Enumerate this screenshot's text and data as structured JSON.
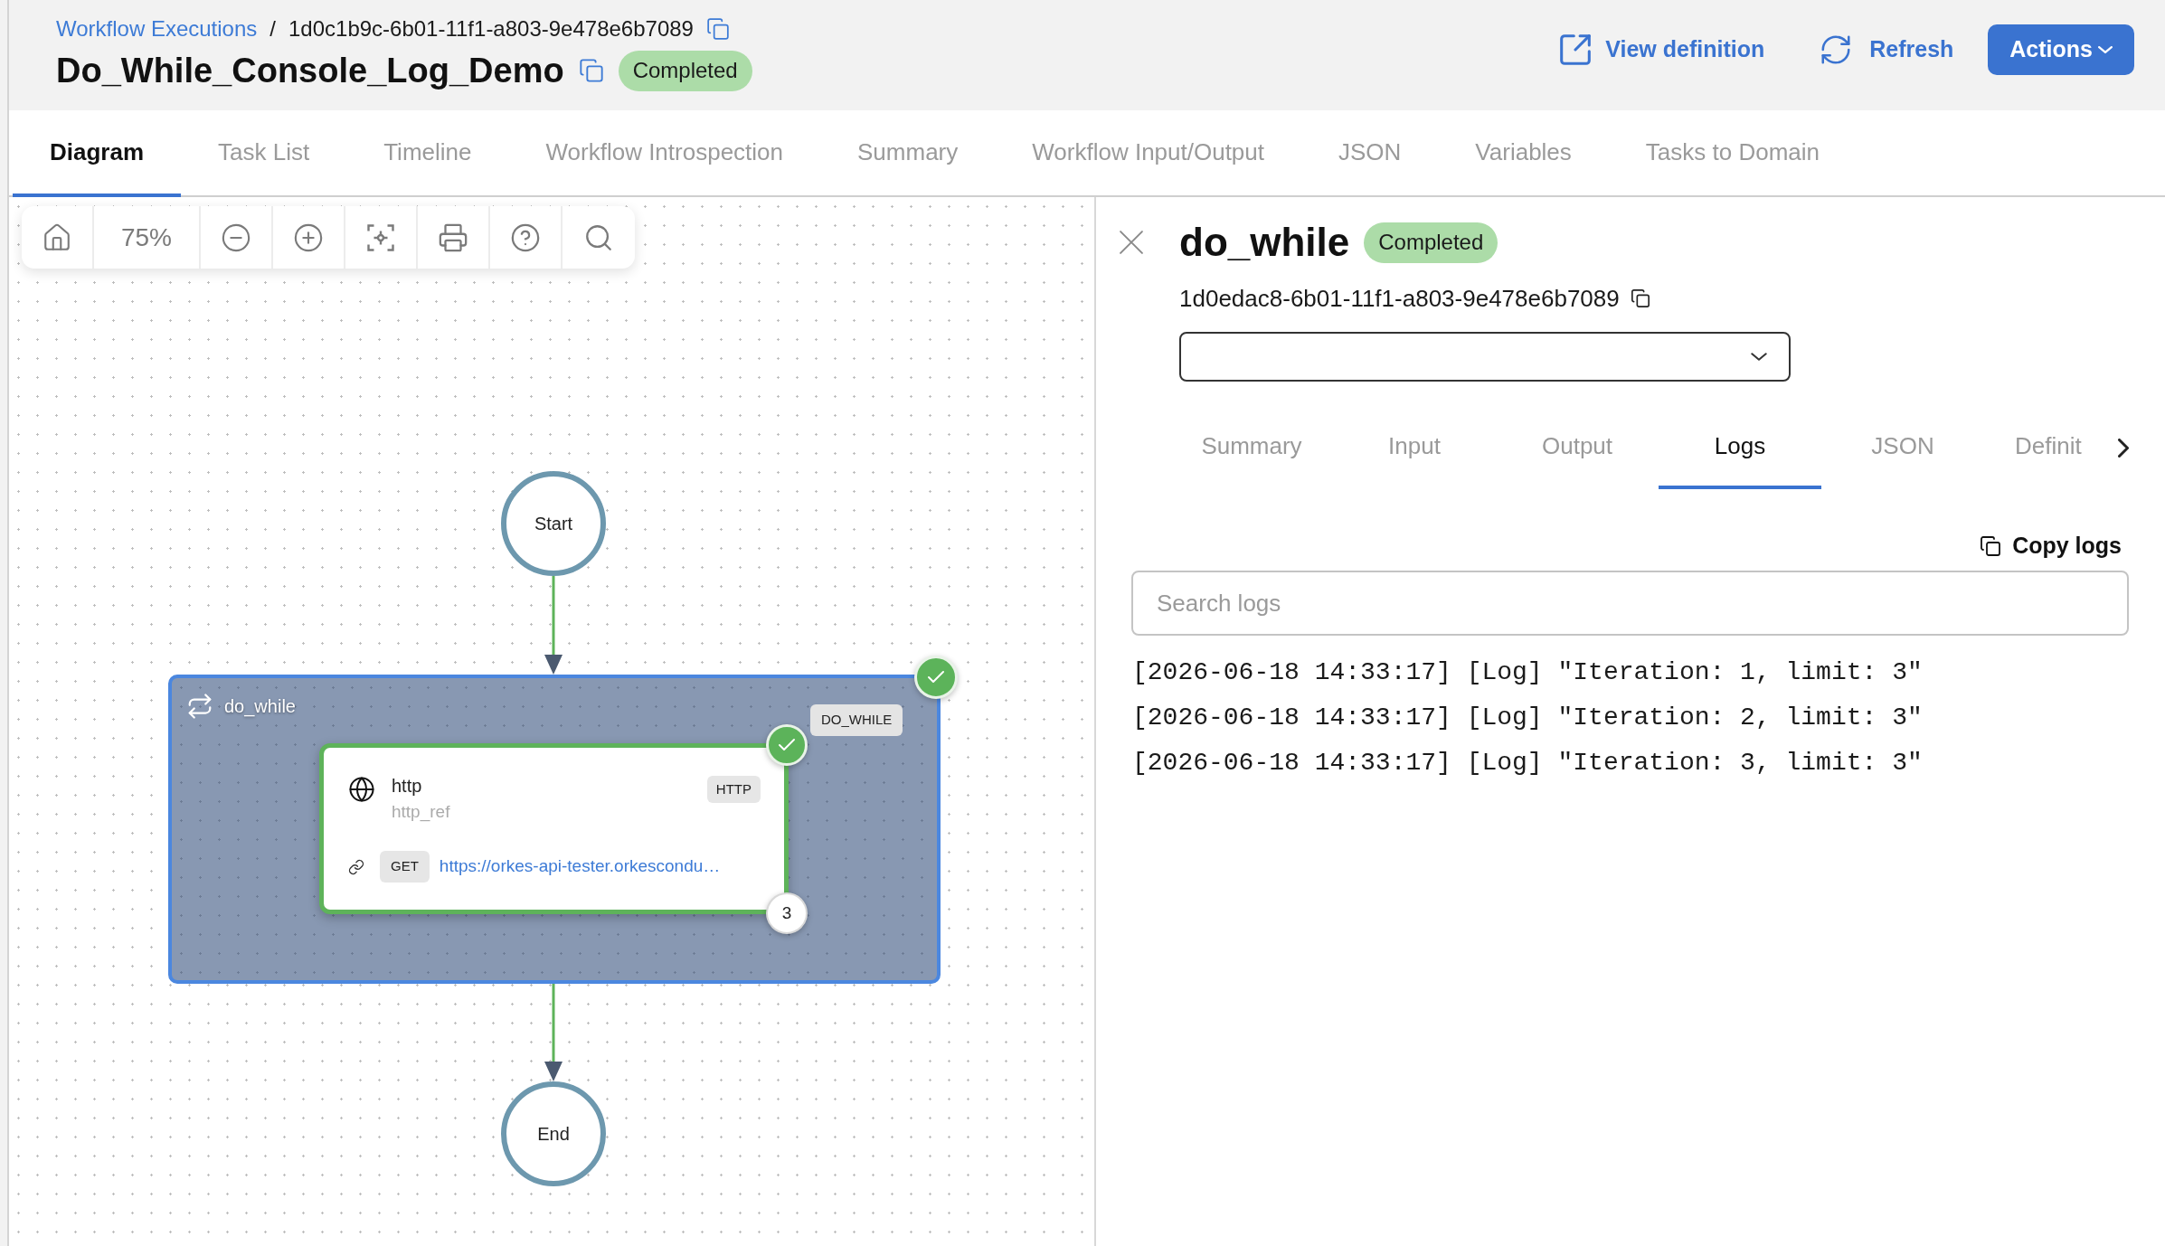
{
  "breadcrumb": {
    "link": "Workflow Executions",
    "separator": "/",
    "current": "1d0c1b9c-6b01-11f1-a803-9e478e6b7089"
  },
  "workflow": {
    "title": "Do_While_Console_Log_Demo",
    "status": "Completed"
  },
  "header_actions": {
    "view_definition": "View definition",
    "refresh": "Refresh",
    "actions_menu": "Actions"
  },
  "tabs": [
    {
      "label": "Diagram",
      "selected": true
    },
    {
      "label": "Task List",
      "selected": false
    },
    {
      "label": "Timeline",
      "selected": false
    },
    {
      "label": "Workflow Introspection",
      "selected": false
    },
    {
      "label": "Summary",
      "selected": false
    },
    {
      "label": "Workflow Input/Output",
      "selected": false
    },
    {
      "label": "JSON",
      "selected": false
    },
    {
      "label": "Variables",
      "selected": false
    },
    {
      "label": "Tasks to Domain",
      "selected": false
    }
  ],
  "diagram": {
    "toolbar": {
      "zoom": "75%"
    },
    "start": "Start",
    "loop": {
      "name": "do_while",
      "type": "DO_WHILE",
      "completed": true,
      "task": {
        "name": "http",
        "ref": "http_ref",
        "type": "HTTP",
        "method": "GET",
        "url": "https://orkes-api-tester.orkescondu…",
        "completed": true,
        "iterations": "3"
      }
    },
    "end": "End"
  },
  "task_panel": {
    "title": "do_while",
    "status": "Completed",
    "id": "1d0edac8-6b01-11f1-a803-9e478e6b7089",
    "tabs": [
      {
        "label": "Summary",
        "selected": false
      },
      {
        "label": "Input",
        "selected": false
      },
      {
        "label": "Output",
        "selected": false
      },
      {
        "label": "Logs",
        "selected": true
      },
      {
        "label": "JSON",
        "selected": false
      },
      {
        "label": "Definit",
        "selected": false
      }
    ],
    "copy_logs": "Copy logs",
    "search": {
      "placeholder": "Search logs"
    },
    "logs": [
      "[2026-06-18 14:33:17] [Log] \"Iteration: 1, limit: 3\"",
      "[2026-06-18 14:33:17] [Log] \"Iteration: 2, limit: 3\"",
      "[2026-06-18 14:33:17] [Log] \"Iteration: 3, limit: 3\""
    ]
  }
}
